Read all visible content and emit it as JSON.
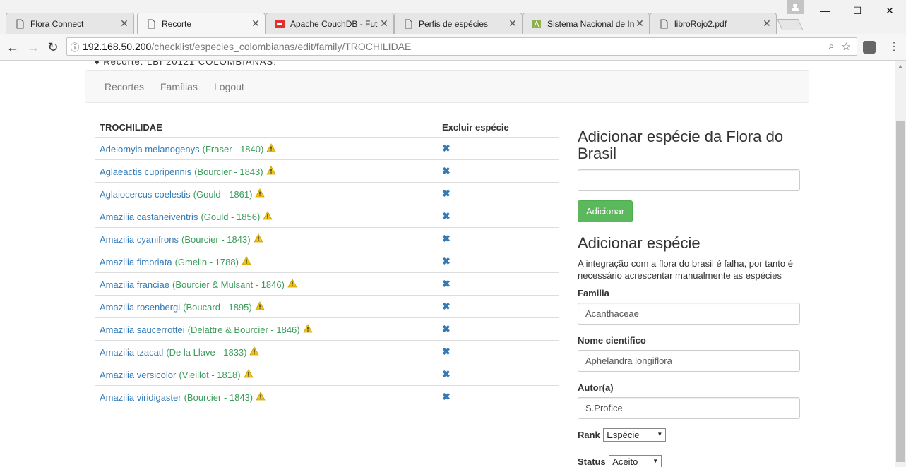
{
  "browser": {
    "tabs": [
      {
        "title": "Flora Connect",
        "active": false
      },
      {
        "title": "Recorte",
        "active": true
      },
      {
        "title": "Apache CouchDB - Fut",
        "active": false
      },
      {
        "title": "Perfis de espécies",
        "active": false
      },
      {
        "title": "Sistema Nacional de In",
        "active": false
      },
      {
        "title": "libroRojo2.pdf",
        "active": false
      }
    ],
    "url_host": "192.168.50.200",
    "url_path": "/checklist/especies_colombianas/edit/family/TROCHILIDAE"
  },
  "page": {
    "top_note": "♦ Recorte: LBI 20121 COLOMBIANAS:",
    "nav": [
      "Recortes",
      "Famílias",
      "Logout"
    ],
    "table": {
      "col_family": "TROCHILIDAE",
      "col_delete": "Excluir espécie",
      "delete_icon": "✖",
      "rows": [
        {
          "name": "Adelomyia melanogenys",
          "author": "(Fraser - 1840)"
        },
        {
          "name": "Aglaeactis cupripennis",
          "author": "(Bourcier - 1843)"
        },
        {
          "name": "Aglaiocercus coelestis",
          "author": "(Gould - 1861)"
        },
        {
          "name": "Amazilia castaneiventris",
          "author": "(Gould - 1856)"
        },
        {
          "name": "Amazilia cyanifrons",
          "author": "(Bourcier - 1843)"
        },
        {
          "name": "Amazilia fimbriata",
          "author": "(Gmelin - 1788)"
        },
        {
          "name": "Amazilia franciae",
          "author": "(Bourcier & Mulsant - 1846)"
        },
        {
          "name": "Amazilia rosenbergi",
          "author": "(Boucard - 1895)"
        },
        {
          "name": "Amazilia saucerrottei",
          "author": "(Delattre & Bourcier - 1846)"
        },
        {
          "name": "Amazilia tzacatl",
          "author": "(De la Llave - 1833)"
        },
        {
          "name": "Amazilia versicolor",
          "author": "(Vieillot - 1818)"
        },
        {
          "name": "Amazilia viridigaster",
          "author": "(Bourcier - 1843)"
        }
      ]
    },
    "side": {
      "flora_title": "Adicionar espécie da Flora do Brasil",
      "flora_input_value": "",
      "add_button": "Adicionar",
      "manual_title": "Adicionar espécie",
      "manual_help": "A integração com a flora do brasil é falha, por tanto é necessário acrescentar manualmente as espécies",
      "family_label": "Familia",
      "family_value": "Acanthaceae",
      "sciname_label": "Nome cientifico",
      "sciname_value": "Aphelandra longiflora",
      "author_label": "Autor(a)",
      "author_value": "S.Profice",
      "rank_label": "Rank",
      "rank_value": "Espécie",
      "status_label": "Status",
      "status_value": "Aceito"
    }
  },
  "colors": {
    "link": "#337ab7",
    "author": "#3c9c5b",
    "warning": "#f0c419",
    "button": "#5cb85c"
  }
}
